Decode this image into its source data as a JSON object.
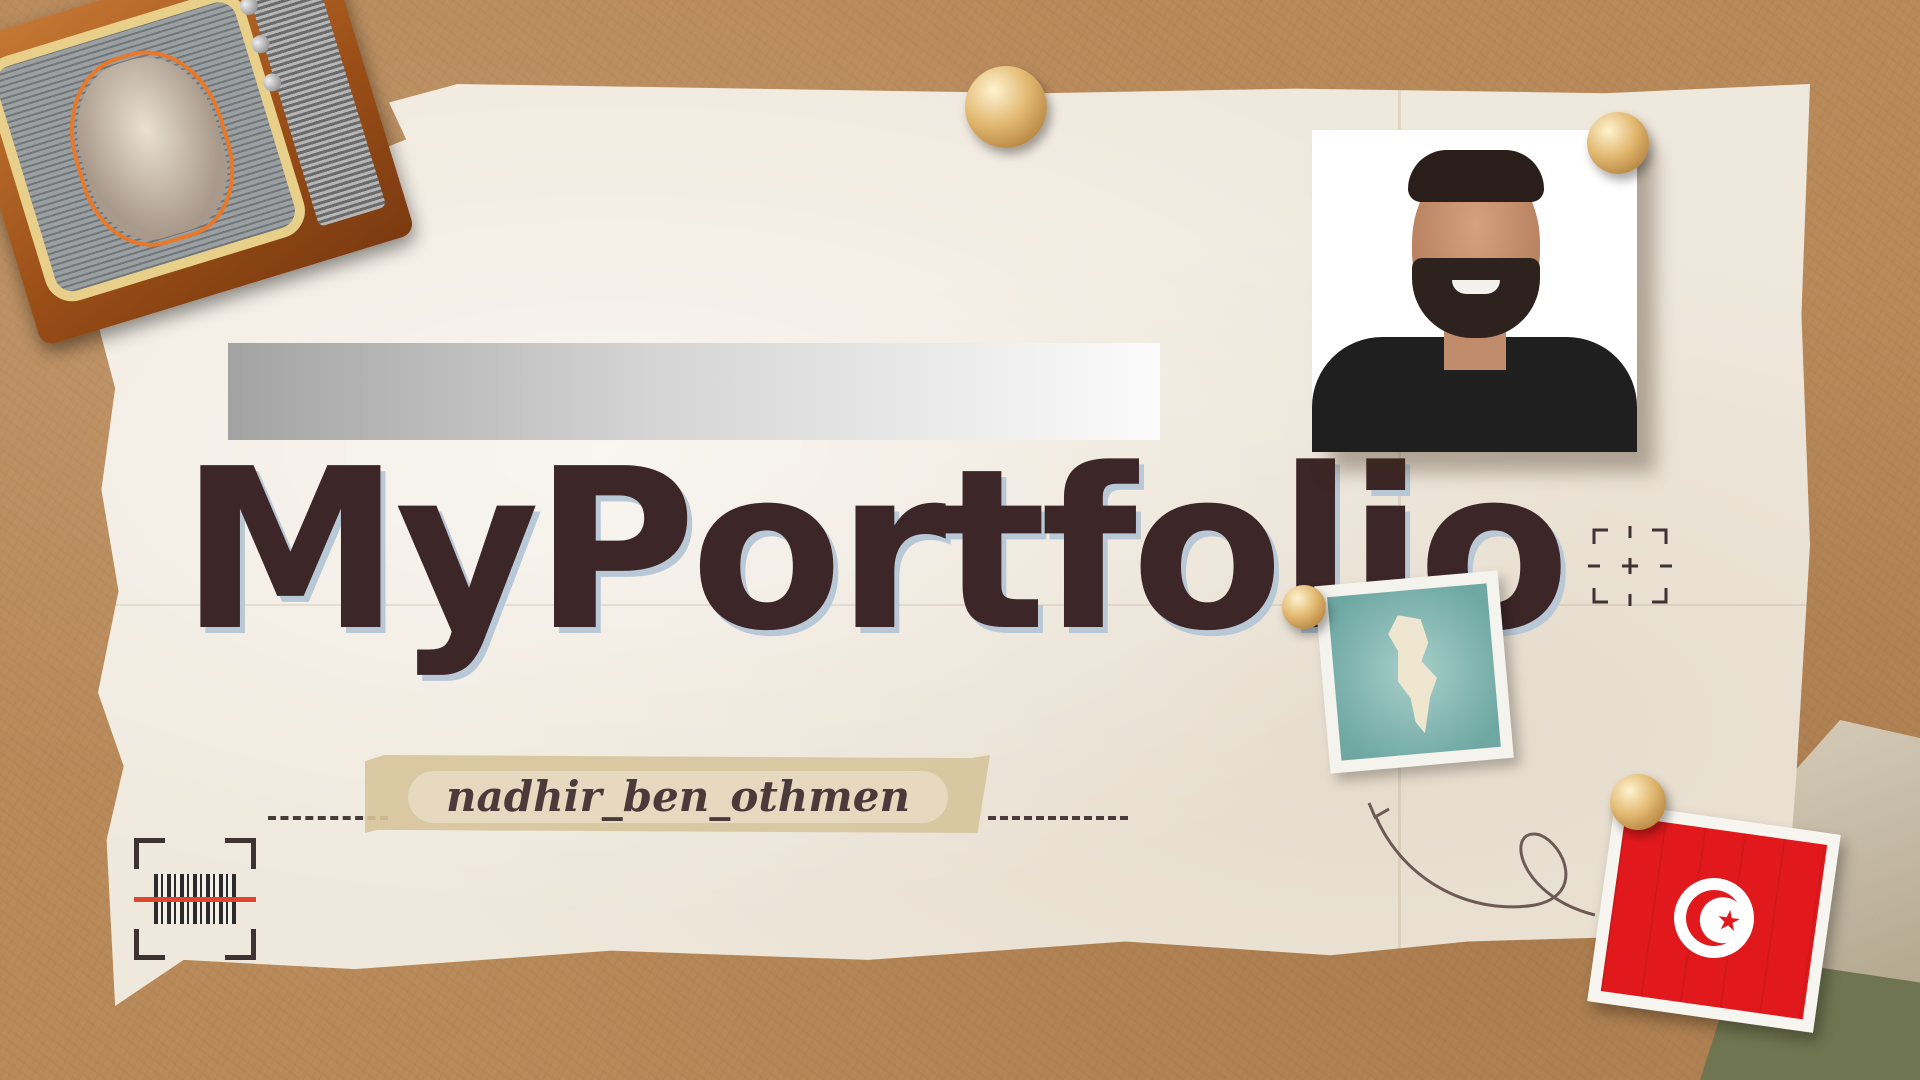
{
  "title": "MyPortfolio",
  "handle": "nadhir_ben_othmen",
  "icons": {
    "tv": "vintage-tv-icon",
    "barcode": "barcode-scanner-icon",
    "crosshair": "crosshair-icon",
    "map": "tunisia-map-icon",
    "flag": "tunisia-flag-icon",
    "pin": "pushpin-icon",
    "arrow": "curved-arrow-icon"
  },
  "colors": {
    "title": "#3d2627",
    "title_shadow": "#b9c8d6",
    "corkboard": "#b98a5a",
    "paper": "#efe8dc",
    "flag_red": "#e2191c"
  }
}
